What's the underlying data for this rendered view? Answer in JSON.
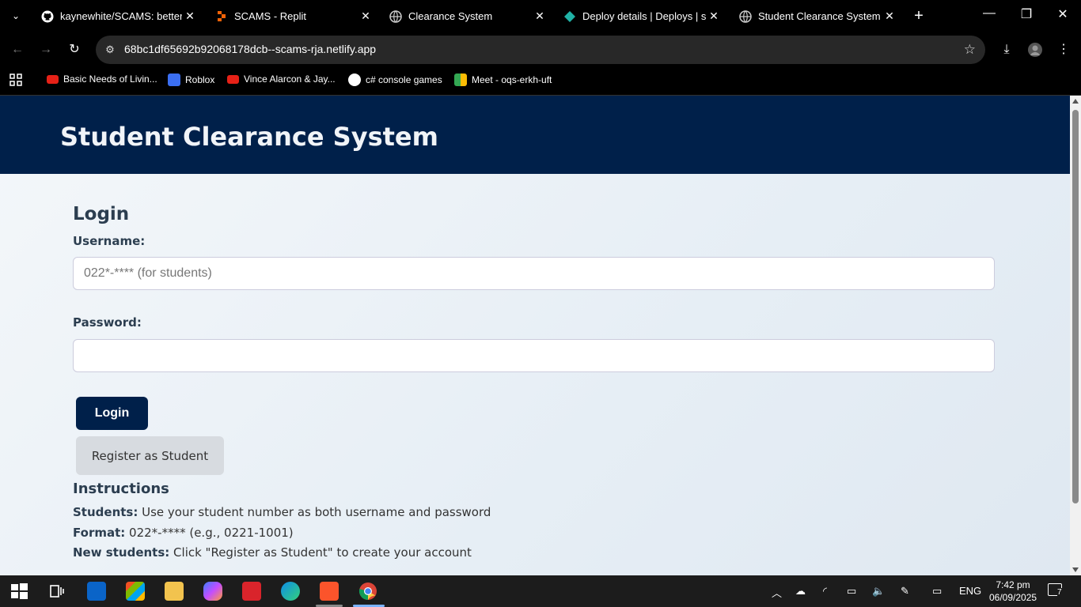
{
  "browser": {
    "tabs": [
      {
        "title": "kaynewhite/SCAMS: better c",
        "favicon": "github-icon"
      },
      {
        "title": "SCAMS - Replit",
        "favicon": "replit-icon"
      },
      {
        "title": "Clearance System",
        "favicon": "globe-icon"
      },
      {
        "title": "Deploy details | Deploys | sc",
        "favicon": "netlify-icon"
      },
      {
        "title": "Student Clearance System",
        "favicon": "globe-icon",
        "active": true
      }
    ],
    "url": "68bc1df65692b92068178dcb--scams-rja.netlify.app",
    "bookmarks": [
      {
        "label": "Basic Needs of Livin...",
        "icon": "youtube-icon",
        "color": "#e62117"
      },
      {
        "label": "Roblox",
        "icon": "roblox-icon",
        "color": "#3b6ff2"
      },
      {
        "label": "Vince Alarcon & Jay...",
        "icon": "youtube-icon",
        "color": "#e62117"
      },
      {
        "label": "c# console games",
        "icon": "github-icon",
        "color": "#ffffff"
      },
      {
        "label": "Meet - oqs-erkh-uft",
        "icon": "meet-icon",
        "color": "#34a853"
      }
    ]
  },
  "page": {
    "header_title": "Student Clearance System",
    "login_title": "Login",
    "username_label": "Username:",
    "username_placeholder": "022*-**** (for students)",
    "password_label": "Password:",
    "login_button": "Login",
    "register_button": "Register as Student",
    "instructions_title": "Instructions",
    "instructions": [
      {
        "bold": "Students:",
        "text": " Use your student number as both username and password"
      },
      {
        "bold": "Format:",
        "text": " 022*-**** (e.g., 0221-1001)"
      },
      {
        "bold": "New students:",
        "text": " Click \"Register as Student\" to create your account"
      }
    ],
    "colors": {
      "header": "#00204a",
      "primary_button": "#00204a",
      "secondary_button": "#d7dbe0"
    }
  },
  "taskbar": {
    "language": "ENG",
    "time": "7:42 pm",
    "date": "06/09/2025",
    "notifications": "7"
  }
}
